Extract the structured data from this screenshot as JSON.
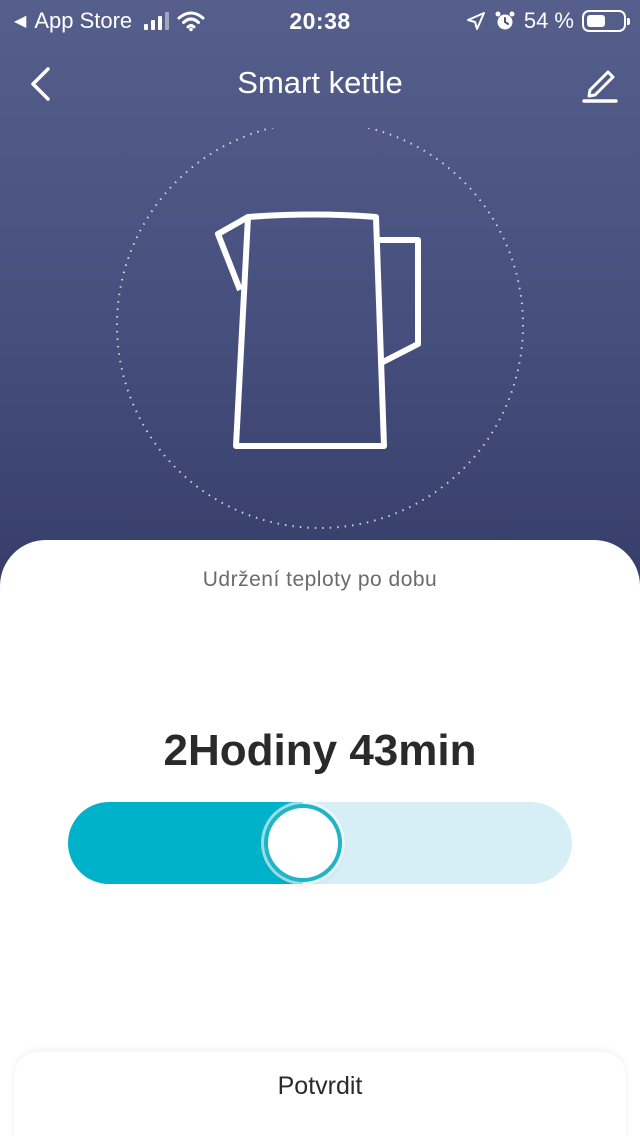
{
  "status_bar": {
    "carrier": "App Store",
    "time": "20:38",
    "battery_percent": "54 %",
    "battery_level": 0.54,
    "signal_icon": "cellular-signal-icon",
    "wifi_icon": "wifi-icon",
    "location_icon": "location-arrow-icon",
    "alarm_icon": "alarm-clock-icon"
  },
  "nav": {
    "title": "Smart kettle",
    "back_icon": "chevron-left-icon",
    "edit_icon": "pencil-icon"
  },
  "hero": {
    "icon": "kettle-icon"
  },
  "sheet": {
    "label": "Udržení teploty po dobu",
    "value": "2Hodiny 43min",
    "slider_level": 0.46,
    "slider_color": "#00b2c9",
    "slider_track_color": "#d6eff6",
    "confirm_label": "Potvrdit"
  }
}
